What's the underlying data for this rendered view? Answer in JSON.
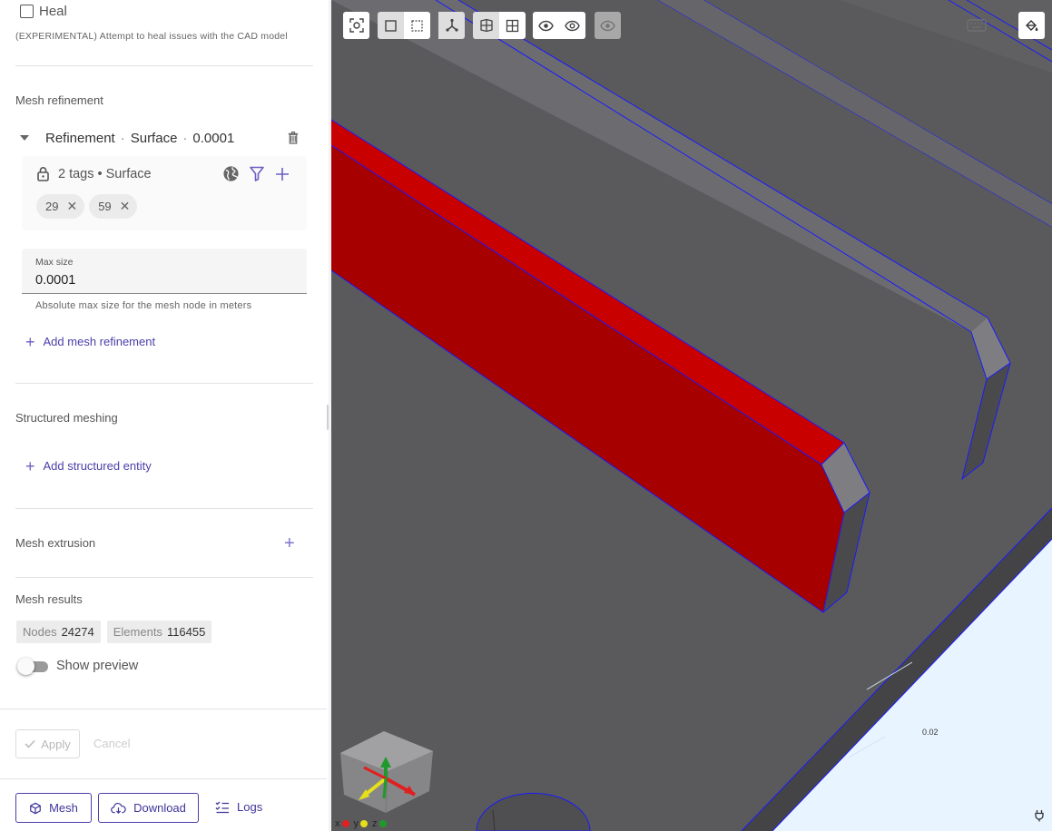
{
  "heal": {
    "label": "Heal",
    "description": "(EXPERIMENTAL) Attempt to heal issues with the CAD model"
  },
  "mesh_refinement": {
    "title": "Mesh refinement",
    "item": {
      "name": "Refinement",
      "type": "Surface",
      "value": "0.0001"
    },
    "tags": {
      "summary": "2 tags • Surface",
      "chips": [
        "29",
        "59"
      ]
    },
    "max_size": {
      "label": "Max size",
      "value": "0.0001",
      "help": "Absolute max size for the mesh node in meters"
    },
    "add_label": "Add mesh refinement"
  },
  "structured_meshing": {
    "title": "Structured meshing",
    "add_label": "Add structured entity"
  },
  "mesh_extrusion": {
    "title": "Mesh extrusion"
  },
  "mesh_results": {
    "title": "Mesh results",
    "nodes_label": "Nodes",
    "nodes_value": "24274",
    "elements_label": "Elements",
    "elements_value": "116455",
    "preview_label": "Show preview"
  },
  "form_actions": {
    "apply_label": "Apply",
    "cancel_label": "Cancel"
  },
  "bottom_actions": {
    "mesh_label": "Mesh",
    "download_label": "Download",
    "logs_label": "Logs"
  },
  "viewport": {
    "scale_label": "0.02",
    "axes": [
      {
        "label": "x",
        "color": "#e02020"
      },
      {
        "label": "y",
        "color": "#e6e01a"
      },
      {
        "label": "z",
        "color": "#1f9a2a"
      }
    ],
    "colors": {
      "selected_surface": "#c80000",
      "geometry": "#5a5a5c",
      "edges": "#1a1aff",
      "ground": "#e8f4ff",
      "accent": "#4b3fa8"
    }
  }
}
